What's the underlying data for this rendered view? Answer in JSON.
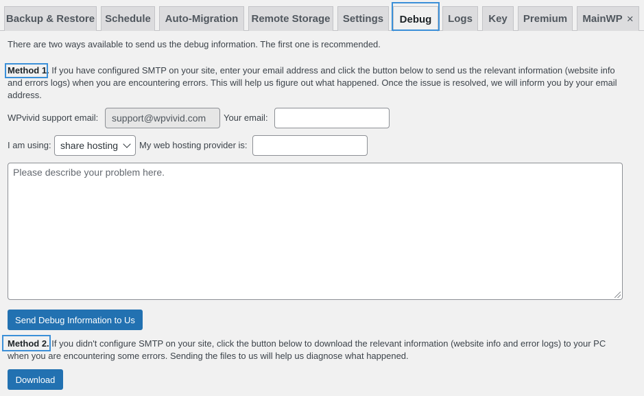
{
  "tabs": [
    {
      "label": "Backup & Restore"
    },
    {
      "label": "Schedule"
    },
    {
      "label": "Auto-Migration"
    },
    {
      "label": "Remote Storage"
    },
    {
      "label": "Settings"
    },
    {
      "label": "Debug",
      "active": true
    },
    {
      "label": "Logs"
    },
    {
      "label": "Key"
    },
    {
      "label": "Premium"
    },
    {
      "label": "MainWP",
      "closable": true
    }
  ],
  "intro": "There are two ways available to send us the debug information. The first one is recommended.",
  "method1": {
    "label": "Method 1.",
    "text_line1": " If you have configured SMTP on your site, enter your email address and click the button below to send us the relevant information (website info",
    "text_line2": "and errors logs) when you are encountering errors. This will help us figure out what happened. Once the issue is resolved, we will inform you by your email",
    "text_line3": "address."
  },
  "form": {
    "support_email_label": "WPvivid support email:",
    "support_email_value": "support@wpvivid.com",
    "your_email_label": "Your email:",
    "your_email_value": "",
    "using_label": "I am using:",
    "using_selected": "share hosting",
    "provider_label": "My web hosting provider is:",
    "provider_value": "",
    "problem_placeholder": "Please describe your problem here.",
    "send_button": "Send Debug Information to Us"
  },
  "method2": {
    "label": "Method 2.",
    "text_line1": " If you didn't configure SMTP on your site, click the button below to download the relevant information (website info and error logs) to your PC",
    "text_line2": "when you are encountering some errors. Sending the files to us will help us diagnose what happened.",
    "download_button": "Download"
  },
  "colors": {
    "accent": "#2271b1",
    "highlight": "#3a8fd8"
  }
}
